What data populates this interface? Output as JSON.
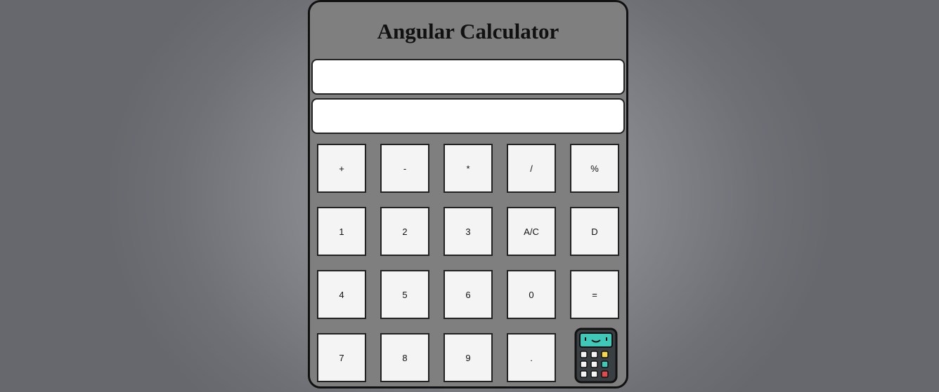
{
  "app": {
    "title": "Angular Calculator"
  },
  "displays": {
    "expression": "",
    "result": ""
  },
  "buttons": {
    "row1": [
      "+",
      "-",
      "*",
      "/",
      "%"
    ],
    "row2": [
      "1",
      "2",
      "3",
      "A/C",
      "D"
    ],
    "row3": [
      "4",
      "5",
      "6",
      "0",
      "="
    ],
    "row4": [
      "7",
      "8",
      "9",
      "."
    ]
  },
  "icon": "calculator-icon",
  "colors": {
    "panel": "#7f7f7f",
    "button": "#f4f4f4",
    "screen_accent": "#3fc7b8",
    "key_yellow": "#f6d84a",
    "key_teal": "#3fc7b8",
    "key_red": "#e24b4b"
  }
}
